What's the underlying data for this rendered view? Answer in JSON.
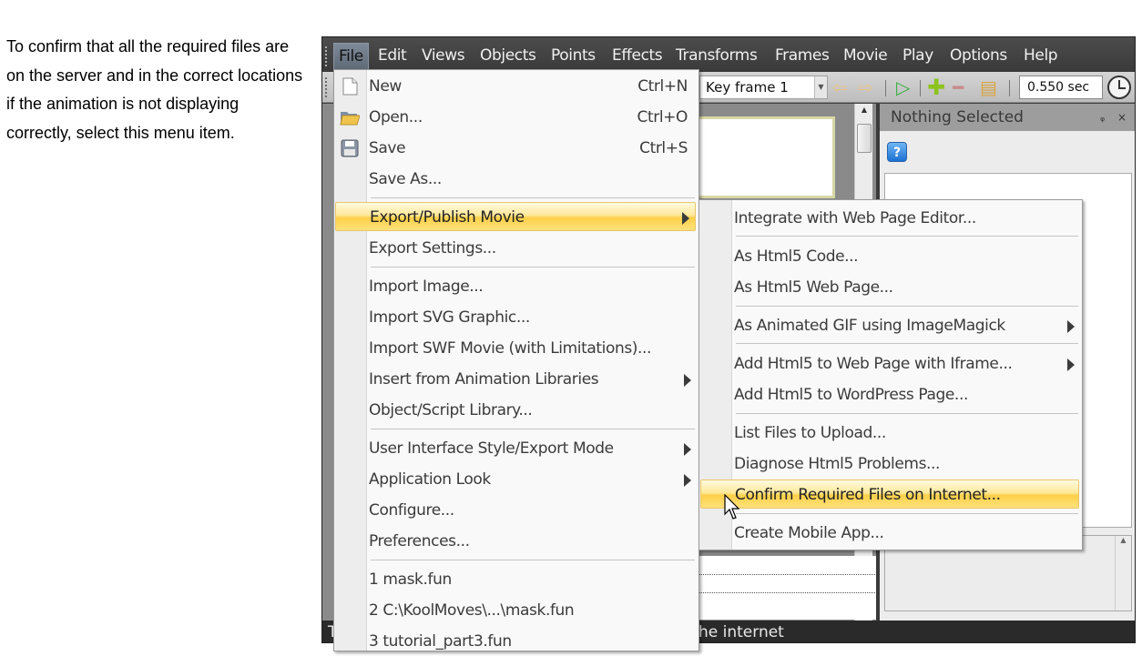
{
  "instruction": "To confirm that all the required files are on the server and in the correct locations if the animation is not displaying correctly, select this menu item.",
  "menubar": [
    "File",
    "Edit",
    "Views",
    "Objects",
    "Points",
    "Effects",
    "Transforms",
    "Frames",
    "Movie",
    "Play",
    "Options",
    "Help"
  ],
  "toolbar": {
    "keyframe_select": "Key frame 1",
    "time_value": "0.550 sec",
    "icons": [
      "prev-keyframe-icon",
      "next-keyframe-icon",
      "play-icon",
      "add-keyframe-icon",
      "remove-keyframe-icon",
      "frames-icon",
      "clock-icon"
    ]
  },
  "right_panel": {
    "title": "Nothing Selected",
    "controls": "ᵩ ×",
    "help": "?"
  },
  "status_bar": {
    "left": "T",
    "text": "he internet"
  },
  "file_menu": {
    "items": [
      {
        "label": "New",
        "shortcut": "Ctrl+N",
        "icon": "new-document-icon"
      },
      {
        "label": "Open...",
        "shortcut": "Ctrl+O",
        "icon": "open-folder-icon"
      },
      {
        "label": "Save",
        "shortcut": "Ctrl+S",
        "icon": "save-disk-icon"
      },
      {
        "label": "Save As..."
      },
      {
        "label": "Export/Publish Movie",
        "submenu": true,
        "highlighted": true
      },
      {
        "label": "Export Settings..."
      },
      {
        "label": "Import Image..."
      },
      {
        "label": "Import SVG Graphic..."
      },
      {
        "label": "Import SWF Movie (with Limitations)..."
      },
      {
        "label": "Insert from Animation Libraries",
        "submenu": true
      },
      {
        "label": "Object/Script Library..."
      },
      {
        "label": "User Interface Style/Export Mode",
        "submenu": true
      },
      {
        "label": "Application Look",
        "submenu": true
      },
      {
        "label": "Configure..."
      },
      {
        "label": "Preferences..."
      },
      {
        "label": "1 mask.fun"
      },
      {
        "label": "2 C:\\KoolMoves\\...\\mask.fun"
      },
      {
        "label": "3 tutorial_part3.fun"
      }
    ]
  },
  "export_menu": {
    "items": [
      {
        "label": "Integrate with Web Page Editor..."
      },
      {
        "label": "As Html5 Code..."
      },
      {
        "label": "As Html5 Web Page..."
      },
      {
        "label": "As Animated GIF using ImageMagick",
        "submenu": true
      },
      {
        "label": "Add Html5 to Web Page with Iframe...",
        "submenu": true
      },
      {
        "label": "Add Html5 to WordPress Page..."
      },
      {
        "label": "List Files to Upload..."
      },
      {
        "label": "Diagnose Html5 Problems..."
      },
      {
        "label": "Confirm Required Files on Internet...",
        "highlighted": true
      },
      {
        "label": "Create Mobile App..."
      }
    ]
  },
  "colors": {
    "highlight": "#fdd048",
    "menubar_bg": "#3f3f3f",
    "menu_bg": "#f9f9f9"
  }
}
